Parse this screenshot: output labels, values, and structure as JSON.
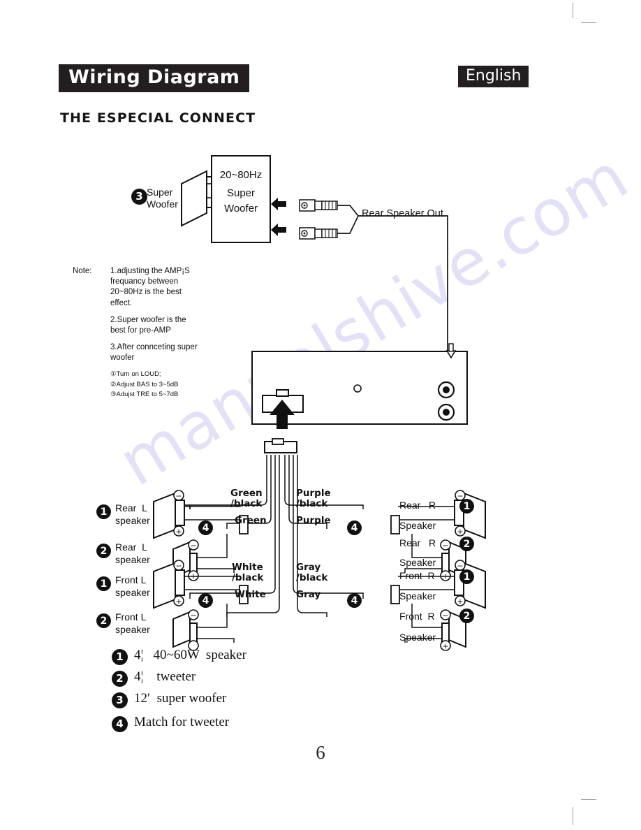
{
  "document": {
    "title_chip": "Wiring Diagram",
    "language_chip": "English",
    "section_title": "THE ESPECIAL CONNECT",
    "page_number": "6",
    "watermark": "manualshive.com"
  },
  "woofer": {
    "marker": "3",
    "speaker_label": "Super\nWoofer",
    "box_freq": "20~80Hz",
    "box_line1": "Super",
    "box_line2": "Woofer",
    "rca_label": "Rear Speaker Out"
  },
  "note": {
    "head": "Note:",
    "item1": "1.adjusting the AMP¡S frequancy between 20~80Hz is the best effect.",
    "item2": "2.Super woofer is the best for pre-AMP",
    "item3": "3.After connceting   super woofer",
    "sub1": "①Turn on LOUD;",
    "sub2": "②Adjust BAS to 3~5dB",
    "sub3": "③Adujst TRE to 5~7dB"
  },
  "speakers": {
    "left": [
      {
        "marker": "1",
        "label": "Rear  L\nspeaker"
      },
      {
        "marker": "2",
        "label": "Rear  L\nspeaker"
      },
      {
        "marker": "1",
        "label": "Front L\nspeaker"
      },
      {
        "marker": "2",
        "label": "Front L\nspeaker"
      }
    ],
    "right": [
      {
        "marker": "1",
        "label_top": "Rear   R",
        "label_bottom": "Speaker"
      },
      {
        "marker": "2",
        "label_top": "Rear   R",
        "label_bottom": "Speaker"
      },
      {
        "marker": "1",
        "label_top": "Front  R",
        "label_bottom": "Speaker"
      },
      {
        "marker": "2",
        "label_top": "Front  R",
        "label_bottom": "Speaker"
      }
    ]
  },
  "wires": {
    "left": [
      {
        "name": "Green\n/black"
      },
      {
        "name": "Green"
      },
      {
        "name": "White\n/black"
      },
      {
        "name": "White"
      }
    ],
    "right": [
      {
        "name": "Purple\n/black"
      },
      {
        "name": "Purple"
      },
      {
        "name": "Gray\n/black"
      },
      {
        "name": "Gray"
      }
    ]
  },
  "tweeter_match_marker": "4",
  "terminals": {
    "negative": "⊖",
    "positive": "⊕"
  },
  "legend": [
    {
      "marker": "1",
      "text": "4¦   40~60W  speaker"
    },
    {
      "marker": "2",
      "text": "4¦    tweeter"
    },
    {
      "marker": "3",
      "text": "12′  super woofer"
    },
    {
      "marker": "4",
      "text": "Match for tweeter"
    }
  ],
  "colors": {
    "ink": "#111111",
    "chip_bg": "#231f20",
    "chip_text": "#ffffff",
    "watermark": "#6a5fd0"
  }
}
